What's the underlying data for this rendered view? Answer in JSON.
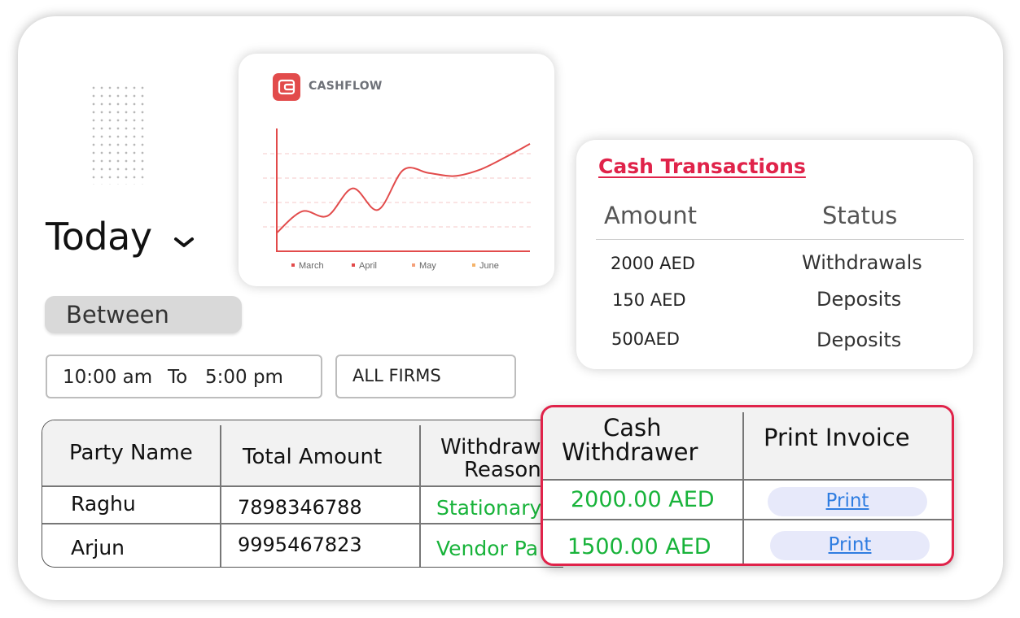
{
  "filters": {
    "today_label": "Today",
    "between_label": "Between",
    "time_from": "10:00 am",
    "time_to_label": "To",
    "time_to": "5:00 pm",
    "firm_select": "ALL FIRMS"
  },
  "cashflow_card": {
    "title": "CASHFLOW",
    "accent_color": "#e24b4b",
    "legend": [
      {
        "label": "March",
        "color": "#e24b4b"
      },
      {
        "label": "April",
        "color": "#e24b4b"
      },
      {
        "label": "May",
        "color": "#f4a07a"
      },
      {
        "label": "June",
        "color": "#f4b36a"
      }
    ]
  },
  "chart_data": {
    "type": "line",
    "title": "",
    "xlabel": "",
    "ylabel": "",
    "grid": true,
    "legend_position": "bottom",
    "series": [
      {
        "values": [
          1.2,
          2.6,
          2.3,
          4.1,
          2.7,
          5.3,
          5.1,
          4.9,
          5.3,
          6.1,
          7.0
        ]
      }
    ]
  },
  "transactions_card": {
    "title": "Cash Transactions",
    "headers": [
      "Amount",
      "Status"
    ],
    "rows": [
      {
        "amount": "2000 AED",
        "status": "Withdrawals"
      },
      {
        "amount": "150 AED",
        "status": "Deposits"
      },
      {
        "amount": "500AED",
        "status": "Deposits"
      }
    ]
  },
  "party_table": {
    "headers": [
      "Party Name",
      "Total Amount",
      "Withdraw",
      "Reason"
    ],
    "rows": [
      {
        "party": "Raghu",
        "amount": "7898346788",
        "reason": "Stationary"
      },
      {
        "party": "Arjun",
        "amount": "9995467823",
        "reason": "Vendor Pa"
      }
    ]
  },
  "withdrawer_table": {
    "header_line1": "Cash",
    "header_line2": "Withdrawer",
    "header_print": "Print Invoice",
    "print_label": "Print",
    "rows": [
      {
        "amount": "2000.00 AED"
      },
      {
        "amount": "1500.00 AED"
      }
    ]
  }
}
